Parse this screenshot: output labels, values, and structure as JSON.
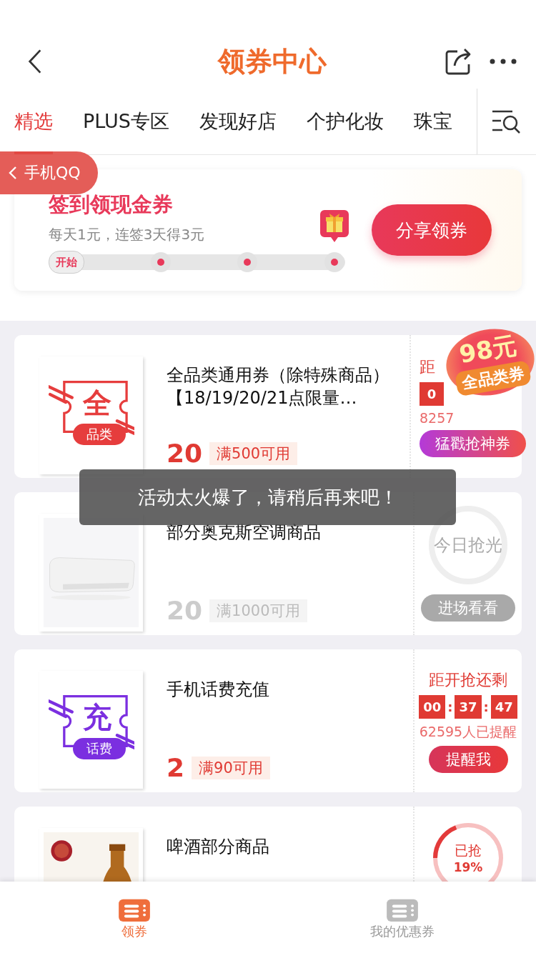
{
  "header": {
    "title": "领券中心"
  },
  "tabs": [
    {
      "label": "精选",
      "selected": true
    },
    {
      "label": "PLUS专区",
      "selected": false
    },
    {
      "label": "发现好店",
      "selected": false
    },
    {
      "label": "个护化妆",
      "selected": false
    },
    {
      "label": "珠宝",
      "selected": false
    }
  ],
  "back_pill": {
    "label": "手机QQ"
  },
  "signin": {
    "title": "签到领现金券",
    "subtitle": "每天1元，连签3天得3元",
    "button": "分享领券",
    "checkpoints": [
      {
        "kind": "start",
        "label": "开始"
      },
      {
        "kind": "dot"
      },
      {
        "kind": "dot"
      },
      {
        "kind": "gift"
      }
    ]
  },
  "coupons": [
    {
      "kind": "countdown",
      "image": {
        "kind": "ticket",
        "glyph": "全",
        "tag": "品类",
        "color": "#e63d3d"
      },
      "title": "全品类通用券（除特殊商品）【18/19/20/21点限量…",
      "amount": "20",
      "condition": "满500可用",
      "countdown_label": "距",
      "timer": [
        "0"
      ],
      "reminded": "8257",
      "button": "猛戳抢神券",
      "badge": {
        "amount": "98元",
        "label": "全品类券"
      }
    },
    {
      "kind": "sold_out",
      "title": "部分奥克斯空调商品",
      "amount": "20",
      "condition": "满1000可用",
      "stamp": "今日抢光",
      "button": "进场看看"
    },
    {
      "kind": "countdown",
      "image": {
        "kind": "ticket",
        "glyph": "充",
        "tag": "话费",
        "color": "#7b2fe0"
      },
      "title": "手机话费充值",
      "amount": "2",
      "condition": "满90可用",
      "countdown_label": "距开抢还剩",
      "timer": [
        "00",
        "37",
        "47"
      ],
      "timer_separator": ":",
      "reminded": "62595人已提醒",
      "button": "提醒我"
    },
    {
      "kind": "progress",
      "title": "啤酒部分商品",
      "progress_label": "已抢",
      "progress_value": "19%",
      "level": 0.19
    }
  ],
  "toast": "活动太火爆了，请稍后再来吧！",
  "bottom_tabs": [
    {
      "label": "领券",
      "selected": true
    },
    {
      "label": "我的优惠券",
      "selected": false
    }
  ]
}
